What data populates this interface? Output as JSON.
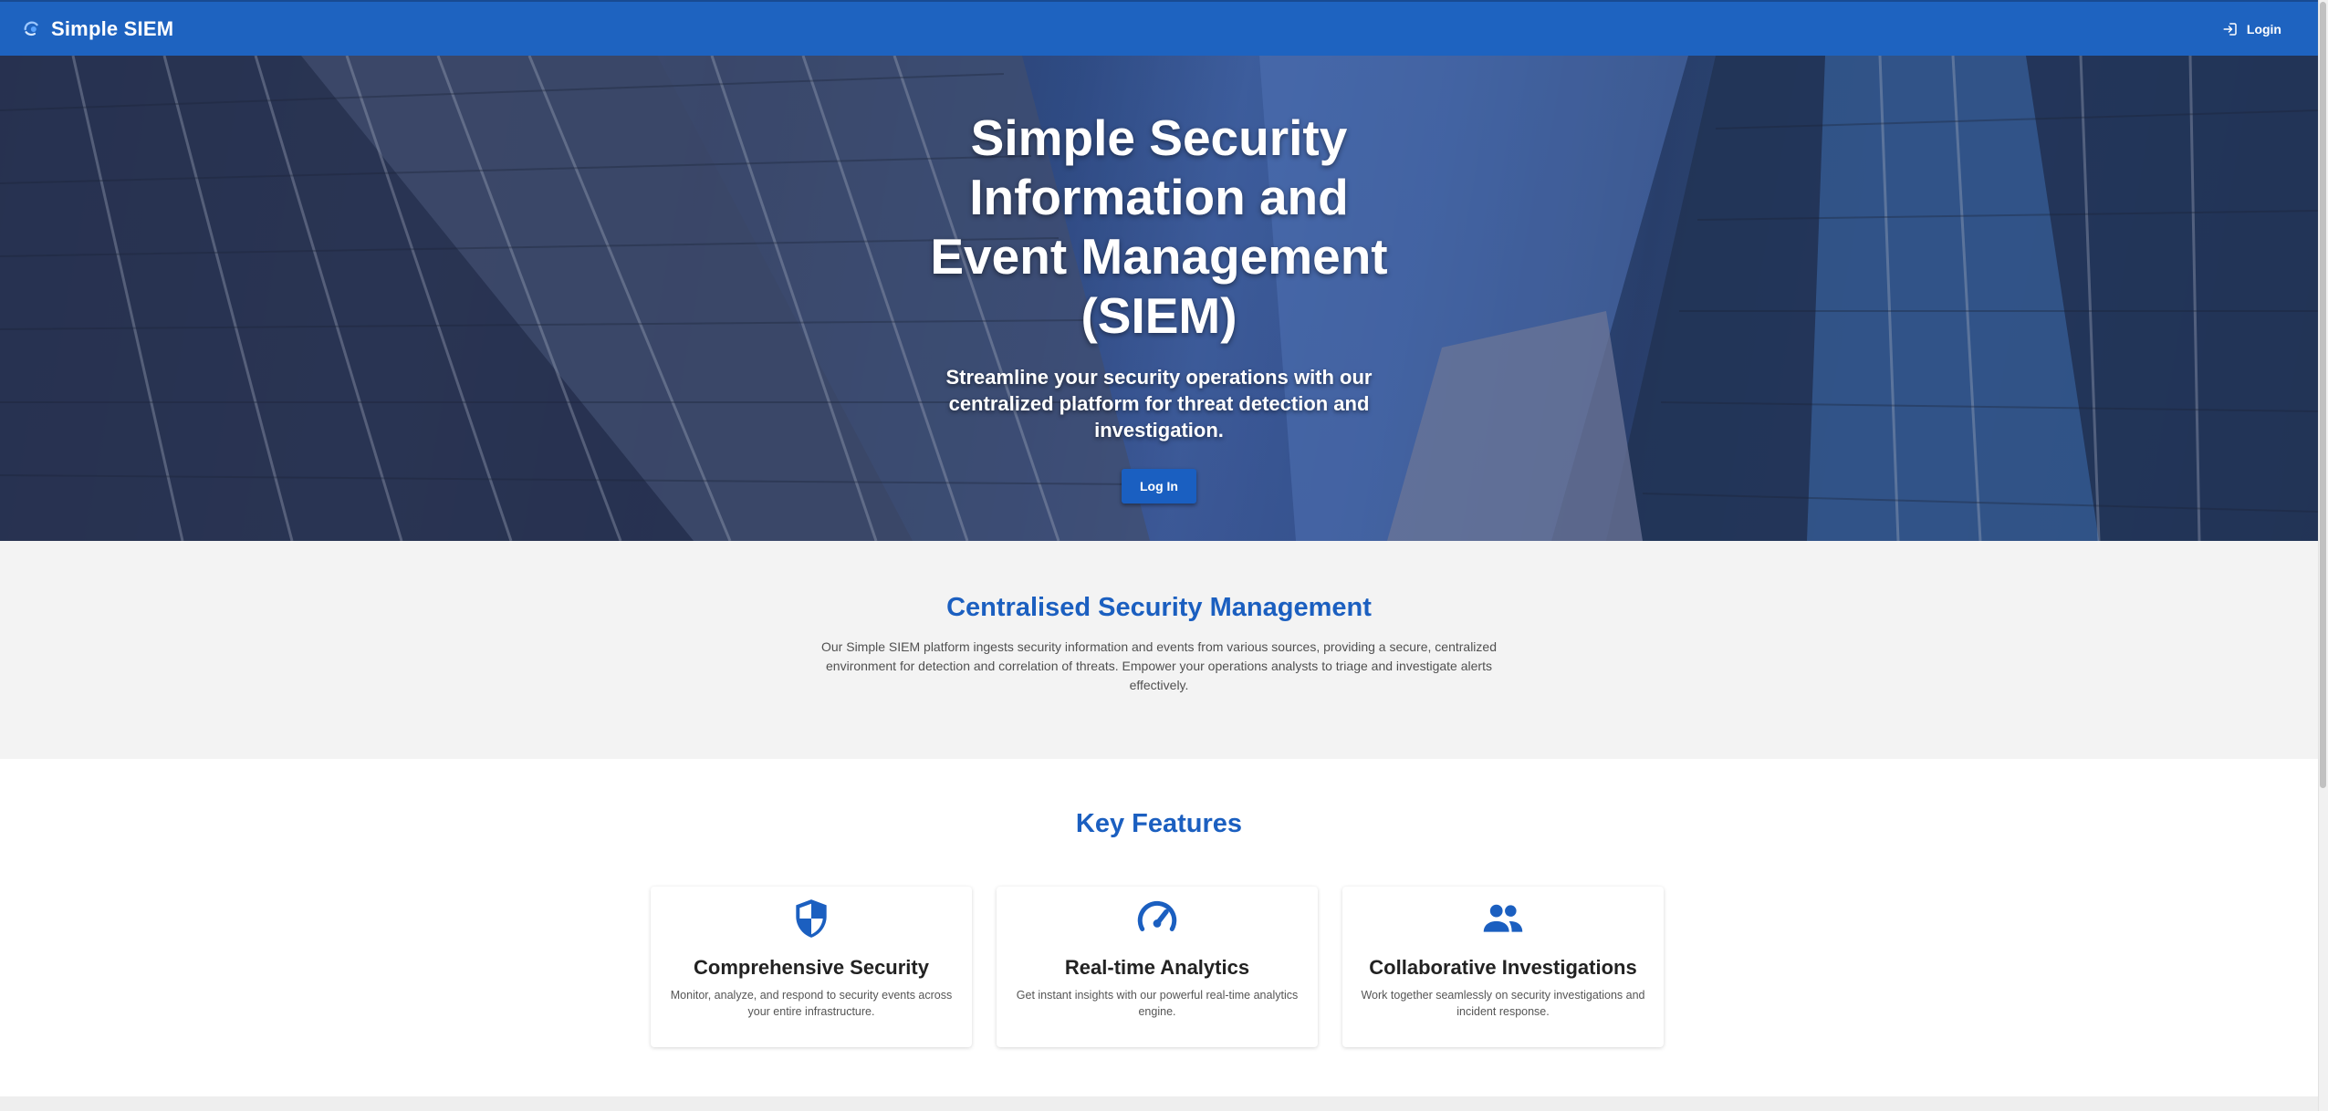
{
  "header": {
    "brand": "Simple SIEM",
    "login_label": "Login",
    "brand_color": "#1e63c0"
  },
  "hero": {
    "title": "Simple Security Information and Event Management (SIEM)",
    "subtitle": "Streamline your security operations with our centralized platform for threat detection and investigation.",
    "button_label": "Log In"
  },
  "central": {
    "title": "Centralised Security Management",
    "description": "Our Simple SIEM platform ingests security information and events from various sources, providing a secure, centralized environment for detection and correlation of threats. Empower your operations analysts to triage and investigate alerts effectively."
  },
  "features": {
    "title": "Key Features",
    "items": [
      {
        "icon": "shield-icon",
        "title": "Comprehensive Security",
        "description": "Monitor, analyze, and respond to security events across your entire infrastructure."
      },
      {
        "icon": "speedometer-icon",
        "title": "Real-time Analytics",
        "description": "Get instant insights with our powerful real-time analytics engine."
      },
      {
        "icon": "people-icon",
        "title": "Collaborative Investigations",
        "description": "Work together seamlessly on security investigations and incident response."
      }
    ]
  },
  "accent_color": "#1b5fc0"
}
